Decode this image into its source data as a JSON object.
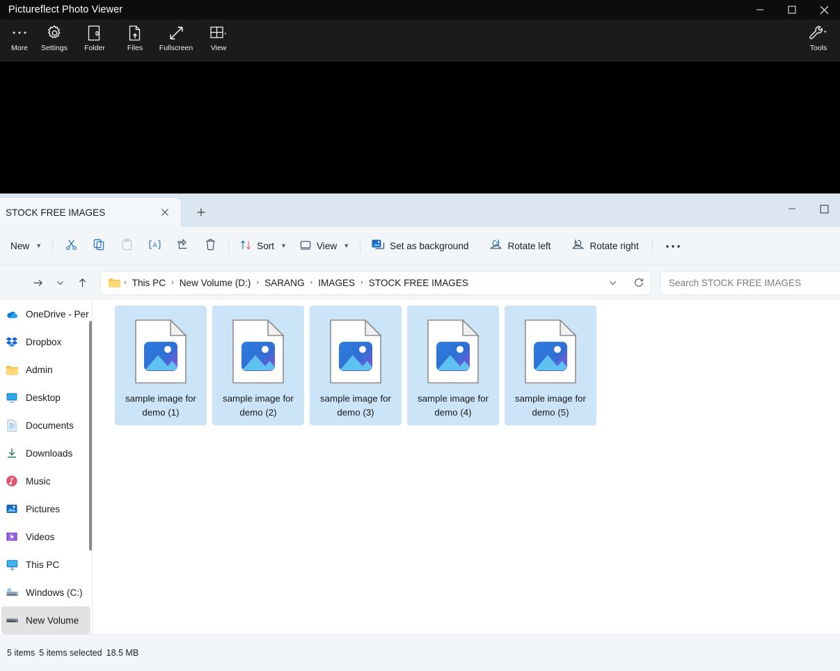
{
  "photo_viewer": {
    "title": "Pictureflect Photo Viewer",
    "window_buttons": [
      {
        "name": "minimize",
        "glyph": "minimize-icon"
      },
      {
        "name": "maximize",
        "glyph": "maximize-icon"
      },
      {
        "name": "close",
        "glyph": "close-icon"
      }
    ],
    "toolbar": [
      {
        "label": "More",
        "icon": "ellipsis-icon"
      },
      {
        "label": "Settings",
        "icon": "gear-icon"
      },
      {
        "label": "Folder",
        "icon": "folder-open-icon"
      },
      {
        "label": "Files",
        "icon": "file-upload-icon"
      },
      {
        "label": "Fullscreen",
        "icon": "fullscreen-arrows-icon"
      },
      {
        "label": "View",
        "icon": "grid-view-icon"
      }
    ],
    "tools": {
      "label": "Tools",
      "icon": "wrench-icon"
    }
  },
  "explorer": {
    "tab": {
      "label": "STOCK FREE IMAGES",
      "close": "×"
    },
    "new_tab": "+",
    "window_buttons": [
      {
        "name": "minimize",
        "glyph": "minimize-icon"
      },
      {
        "name": "maximize",
        "glyph": "maximize-icon"
      }
    ],
    "command_bar": {
      "new_label": "New",
      "cut": "cut-icon",
      "copy": "copy-icon",
      "paste": "paste-icon",
      "rename": "rename-icon",
      "share": "share-icon",
      "delete": "delete-icon",
      "sort_label": "Sort",
      "view_label": "View",
      "set_as_background_label": "Set as background",
      "rotate_left_label": "Rotate left",
      "rotate_right_label": "Rotate right",
      "overflow": "···"
    },
    "address_bar": {
      "forward_icon": "arrow-right-icon",
      "recent_icon": "chevron-down-icon",
      "up_icon": "arrow-up-icon",
      "folder_icon": "folder-icon",
      "breadcrumbs": [
        "This PC",
        "New Volume (D:)",
        "SARANG",
        "IMAGES",
        "STOCK FREE IMAGES"
      ],
      "separator": "›",
      "dropdown_icon": "chevron-down-icon",
      "refresh_icon": "refresh-icon"
    },
    "search": {
      "placeholder": "Search STOCK FREE IMAGES",
      "value": ""
    },
    "sidebar": {
      "items": [
        {
          "label": "OneDrive - Per",
          "icon": "onedrive-icon",
          "selected": false
        },
        {
          "label": "Dropbox",
          "icon": "dropbox-icon",
          "selected": false
        },
        {
          "label": "Admin",
          "icon": "folder-icon",
          "selected": false
        },
        {
          "label": "Desktop",
          "icon": "desktop-icon",
          "selected": false
        },
        {
          "label": "Documents",
          "icon": "documents-icon",
          "selected": false
        },
        {
          "label": "Downloads",
          "icon": "download-icon",
          "selected": false
        },
        {
          "label": "Music",
          "icon": "music-icon",
          "selected": false
        },
        {
          "label": "Pictures",
          "icon": "pictures-icon",
          "selected": false
        },
        {
          "label": "Videos",
          "icon": "videos-icon",
          "selected": false
        },
        {
          "label": "This PC",
          "icon": "pc-icon",
          "selected": false
        },
        {
          "label": "Windows (C:)",
          "icon": "drive-icon",
          "selected": false
        },
        {
          "label": "New Volume",
          "icon": "drive-icon",
          "selected": true
        }
      ]
    },
    "files": [
      {
        "name": "sample image for demo (1)",
        "icon": "image-file-icon",
        "selected": true
      },
      {
        "name": "sample image for demo (2)",
        "icon": "image-file-icon",
        "selected": true
      },
      {
        "name": "sample image for demo (3)",
        "icon": "image-file-icon",
        "selected": true
      },
      {
        "name": "sample image for demo (4)",
        "icon": "image-file-icon",
        "selected": true
      },
      {
        "name": "sample image for demo (5)",
        "icon": "image-file-icon",
        "selected": true
      }
    ],
    "status_bar": {
      "item_count": "5 items",
      "selection": "5 items selected",
      "size": "18.5 MB"
    }
  },
  "colors": {
    "accent": "#0067c0",
    "selection": "#cce4f7",
    "viewer_bg": "#000000",
    "tabstrip": "#dce6f0"
  }
}
